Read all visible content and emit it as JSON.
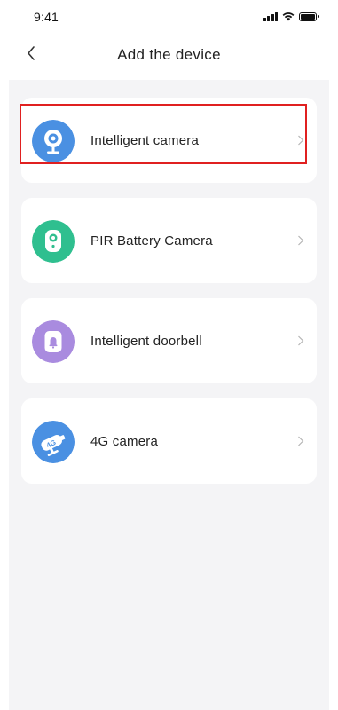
{
  "status_bar": {
    "time": "9:41",
    "wifi_icon": "wifi-icon",
    "signal_icon": "signal-icon",
    "battery_icon": "battery-icon"
  },
  "nav": {
    "back_icon": "chevron-left-icon",
    "title": "Add the device"
  },
  "devices": [
    {
      "label": "Intelligent camera",
      "icon": "camera-icon",
      "icon_color": "#4a90e2"
    },
    {
      "label": "PIR Battery Camera",
      "icon": "battery-camera-icon",
      "icon_color": "#2fbf8f"
    },
    {
      "label": "Intelligent doorbell",
      "icon": "doorbell-icon",
      "icon_color": "#a98bdf"
    },
    {
      "label": "4G camera",
      "icon": "4g-camera-icon",
      "icon_color": "#4a90e2",
      "icon_text": "4G"
    }
  ],
  "highlight_color": "#e02020"
}
